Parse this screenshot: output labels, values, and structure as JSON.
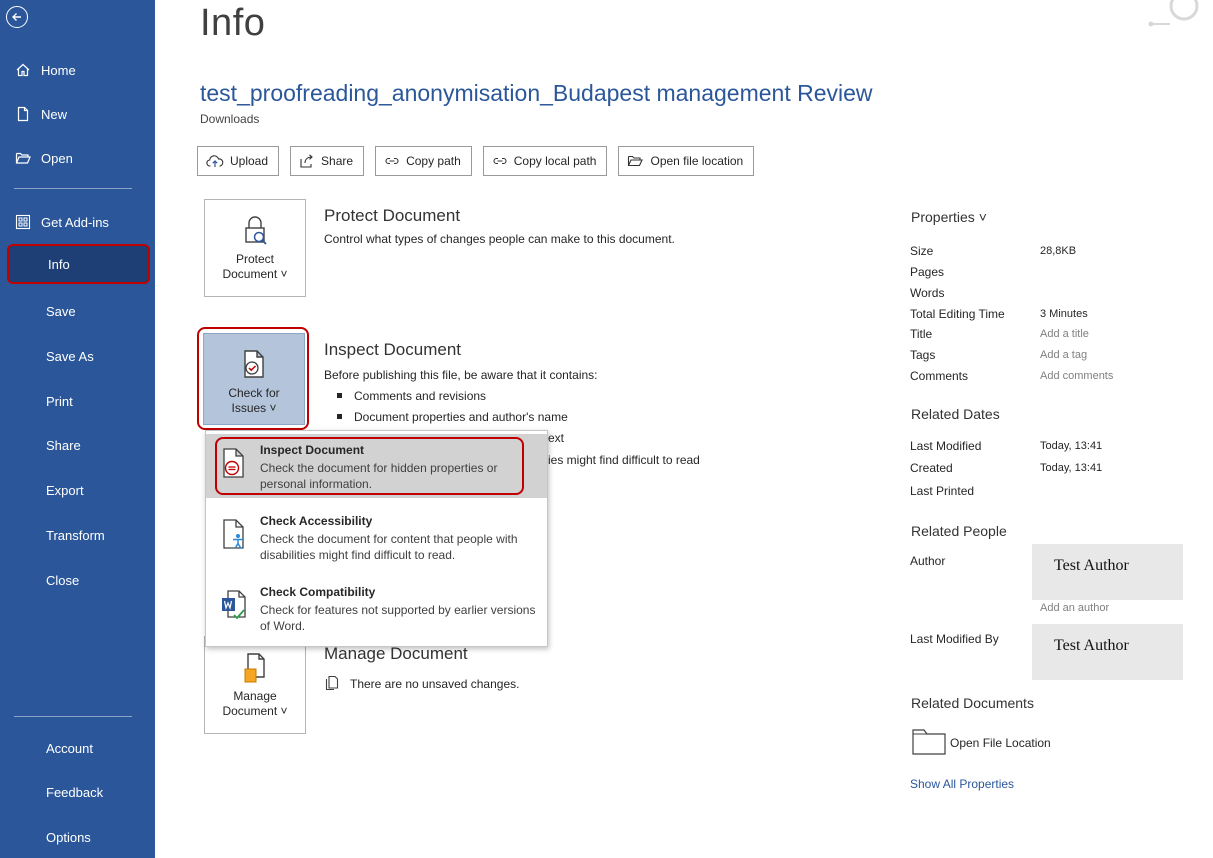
{
  "sidebar": {
    "home": "Home",
    "new": "New",
    "open": "Open",
    "get_addins": "Get Add-ins",
    "info": "Info",
    "save": "Save",
    "save_as": "Save As",
    "print": "Print",
    "share": "Share",
    "export": "Export",
    "transform": "Transform",
    "close": "Close",
    "account": "Account",
    "feedback": "Feedback",
    "options": "Options"
  },
  "header": {
    "page_title": "Info",
    "doc_title": "test_proofreading_anonymisation_Budapest management Review",
    "location": "Downloads"
  },
  "toolbar": {
    "upload": "Upload",
    "share": "Share",
    "copy_path": "Copy path",
    "copy_local_path": "Copy local path",
    "open_file_location": "Open file location"
  },
  "protect": {
    "button_line1": "Protect",
    "button_line2": "Document ˅",
    "title": "Protect Document",
    "desc": "Control what types of changes people can make to this document."
  },
  "inspect": {
    "button_line1": "Check for",
    "button_line2": "Issues ˅",
    "title": "Inspect Document",
    "desc": "Before publishing this file, be aware that it contains:",
    "bullets": [
      "Comments and revisions",
      "Document properties and author's name"
    ],
    "partial_1": "ext",
    "partial_2": "ies might find difficult to read"
  },
  "dropdown": {
    "inspect_title": "Inspect Document",
    "inspect_desc": "Check the document for hidden properties or personal information.",
    "access_title": "Check Accessibility",
    "access_desc": "Check the document for content that people with disabilities might find difficult to read.",
    "compat_title": "Check Compatibility",
    "compat_desc": "Check for features not supported by earlier versions of Word."
  },
  "manage": {
    "button_line1": "Manage",
    "button_line2": "Document ˅",
    "title": "Manage Document",
    "desc": "There are no unsaved changes."
  },
  "properties": {
    "heading": "Properties ˅",
    "size_label": "Size",
    "size_value": "28,8KB",
    "pages_label": "Pages",
    "words_label": "Words",
    "editing_label": "Total Editing Time",
    "editing_value": "3 Minutes",
    "title_label": "Title",
    "title_value": "Add a title",
    "tags_label": "Tags",
    "tags_value": "Add a tag",
    "comments_label": "Comments",
    "comments_value": "Add comments"
  },
  "related_dates": {
    "heading": "Related Dates",
    "modified_label": "Last Modified",
    "modified_value": "Today, 13:41",
    "created_label": "Created",
    "created_value": "Today, 13:41",
    "printed_label": "Last Printed"
  },
  "related_people": {
    "heading": "Related People",
    "author_label": "Author",
    "author_value": "Test Author",
    "add_author": "Add an author",
    "modified_by_label": "Last Modified By",
    "modified_by_value": "Test Author"
  },
  "related_documents": {
    "heading": "Related Documents",
    "open_location": "Open File Location",
    "show_all": "Show All Properties"
  },
  "colors": {
    "sidebar": "#2b579a",
    "accent": "#2b579a",
    "highlight": "#c00000"
  }
}
